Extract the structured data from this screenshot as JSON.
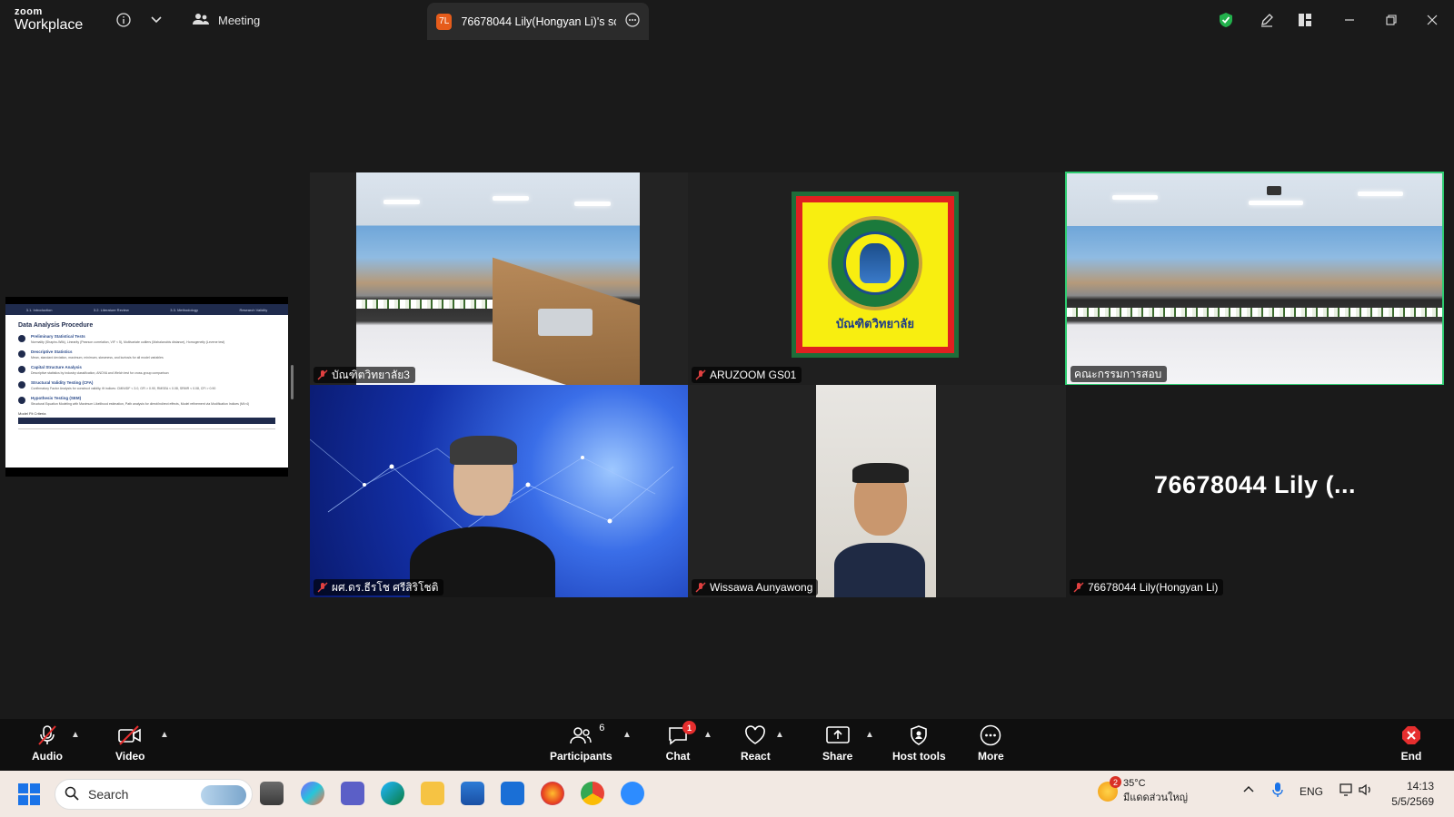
{
  "titlebar": {
    "brand_top": "zoom",
    "brand_bottom": "Workplace",
    "meeting_label": "Meeting",
    "share_tab_badge": "7L",
    "share_tab_label": "76678044 Lily(Hongyan Li)'s scree"
  },
  "shared_slide": {
    "nav": [
      "3.1. Introduction",
      "3.2. Literature Review",
      "3.3. Methodology",
      "Research Validity"
    ],
    "title": "Data Analysis Procedure",
    "steps": [
      {
        "n": "1",
        "title": "Preliminary Statistical Tests",
        "body": "Normality (Shapiro-Wilk), Linearity (Pearson correlation, VIF < 5), Multivariate outliers (Mahalanobis distance), Homogeneity (Levene test)"
      },
      {
        "n": "2",
        "title": "Descriptive Statistics",
        "body": "Mean, standard deviation, maximum, minimum, skewness, and kurtosis for all model variables"
      },
      {
        "n": "3",
        "title": "Capital Structure Analysis",
        "body": "Descriptive statistics by industry classification, ANOVA and Welch test for cross-group comparison"
      },
      {
        "n": "4",
        "title": "Structural Validity Testing (CFA)",
        "body": "Confirmatory Factor Analysis for construct validity, fit indices: CMIN/DF < 3.0, GFI > 0.90, RMSEA < 0.08, SRMR < 0.08, CFI > 0.90"
      },
      {
        "n": "5",
        "title": "Hypothesis Testing (SEM)",
        "body": "Structural Equation Modeling with Maximum Likelihood estimation, Path analysis for direct/indirect effects, Model refinement via Modification Indices (MI>4)"
      }
    ],
    "table_caption": "Model Fit Criteria"
  },
  "participants": [
    {
      "name": "บัณฑิตวิทยาลัย3",
      "type": "video-room"
    },
    {
      "name": "ARUZOOM GS01",
      "type": "emblem",
      "emblem_text": "บัณฑิตวิทยาลัย"
    },
    {
      "name": "คณะกรรมการสอบ",
      "type": "video-room",
      "active": true
    },
    {
      "name": "ผศ.ดร.ธีรโช ศรีสิริโชติ",
      "type": "video-network"
    },
    {
      "name": "Wissawa Aunyawong",
      "type": "video-person"
    },
    {
      "name": "76678044 Lily(Hongyan Li)",
      "type": "name-only",
      "display": "76678044  Lily  (..."
    }
  ],
  "toolbar": {
    "audio": "Audio",
    "video": "Video",
    "participants": "Participants",
    "participants_count": "6",
    "chat": "Chat",
    "chat_badge": "1",
    "react": "React",
    "share": "Share",
    "host_tools": "Host tools",
    "more": "More",
    "end": "End"
  },
  "taskbar": {
    "search_placeholder": "Search",
    "weather_temp": "35°C",
    "weather_loc": "มีแดดส่วนใหญ่",
    "weather_badge": "2",
    "language": "ENG",
    "time": "14:13",
    "date": "5/5/2569"
  },
  "colors": {
    "active_speaker": "#2ecc71",
    "end_button": "#e62e2e",
    "emblem_yellow": "#f8ee10",
    "emblem_red": "#e02020"
  }
}
